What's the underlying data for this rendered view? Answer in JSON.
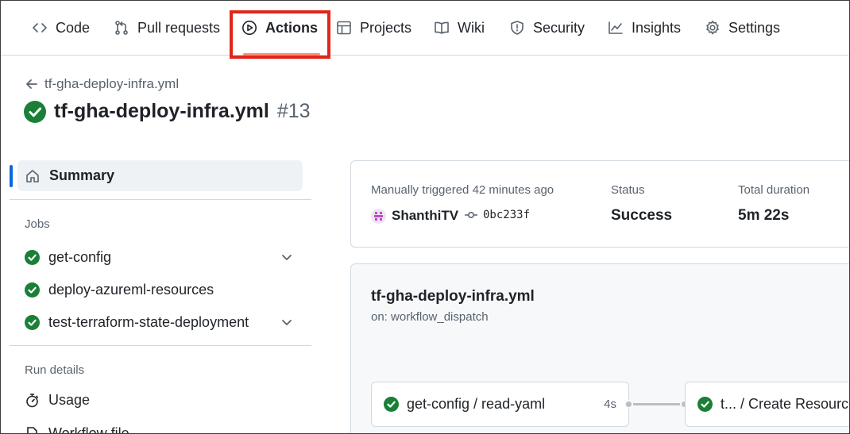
{
  "nav": {
    "items": [
      {
        "label": "Code",
        "icon": "code-icon"
      },
      {
        "label": "Pull requests",
        "icon": "git-pull-request-icon"
      },
      {
        "label": "Actions",
        "icon": "play-icon",
        "active": true
      },
      {
        "label": "Projects",
        "icon": "table-icon"
      },
      {
        "label": "Wiki",
        "icon": "book-icon"
      },
      {
        "label": "Security",
        "icon": "shield-icon"
      },
      {
        "label": "Insights",
        "icon": "graph-icon"
      },
      {
        "label": "Settings",
        "icon": "gear-icon"
      }
    ]
  },
  "header": {
    "back_label": "tf-gha-deploy-infra.yml",
    "title": "tf-gha-deploy-infra.yml",
    "run_number": "#13"
  },
  "sidebar": {
    "summary_label": "Summary",
    "jobs_heading": "Jobs",
    "jobs": [
      {
        "label": "get-config",
        "expandable": true
      },
      {
        "label": "deploy-azureml-resources",
        "expandable": false
      },
      {
        "label": "test-terraform-state-deployment",
        "expandable": true
      }
    ],
    "run_details_heading": "Run details",
    "usage_label": "Usage",
    "workflow_file_label": "Workflow file"
  },
  "summary": {
    "trigger_text": "Manually triggered 42 minutes ago",
    "actor": "ShanthiTV",
    "commit_sha": "0bc233f",
    "status_label": "Status",
    "status_value": "Success",
    "duration_label": "Total duration",
    "duration_value": "5m 22s"
  },
  "graph": {
    "workflow_name": "tf-gha-deploy-infra.yml",
    "trigger": "on: workflow_dispatch",
    "nodes": [
      {
        "label": "get-config / read-yaml",
        "duration": "4s"
      },
      {
        "label": "t... / Create Resources"
      }
    ]
  },
  "colors": {
    "success": "#1a7f37",
    "accent": "#0969da",
    "active_tab_underline": "#fd8c73",
    "highlight": "#e1251b"
  }
}
